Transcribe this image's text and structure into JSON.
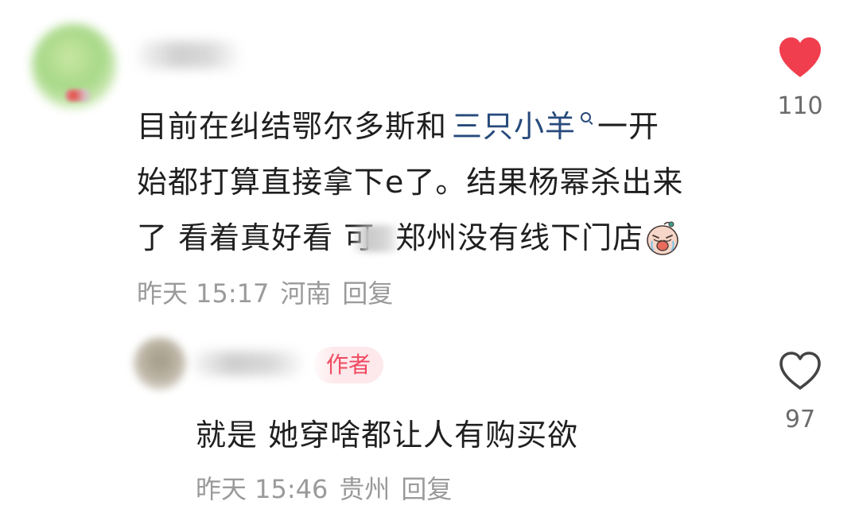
{
  "comment": {
    "text_line1_before": "目前在纠结鄂尔多斯和",
    "topic_link": "三只小羊",
    "text_line1_after": "一开",
    "text_line2": "始都打算直接拿下e了。结果杨幂杀出来",
    "text_line3_before": "了 看着真好看 可",
    "text_line3_after": "郑州没有线下门店",
    "emoji": "crying-face-emoji",
    "time": "昨天 15:17",
    "location": "河南",
    "reply_label": "回复",
    "likes": "110",
    "liked": true,
    "like_color": "#f03e4e"
  },
  "reply": {
    "author_badge": "作者",
    "text": "就是 她穿啥都让人有购买欲",
    "time": "昨天 15:46",
    "location": "贵州",
    "reply_label": "回复",
    "likes": "97",
    "liked": false
  },
  "colors": {
    "link": "#274a7c",
    "meta": "#9a9a9a",
    "badge_text": "#ef4a61",
    "badge_bg": "#fde8eb"
  },
  "icons": {
    "like_filled": "heart-filled-icon",
    "like_outline": "heart-outline-icon",
    "topic": "search-icon"
  }
}
